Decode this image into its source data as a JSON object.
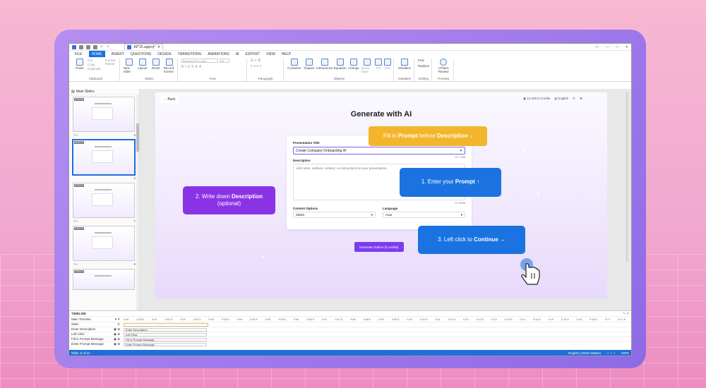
{
  "app": {
    "title": "AP'15.approj*",
    "win_controls": [
      "—",
      "□",
      "✕"
    ]
  },
  "menu": [
    "FILE",
    "HOME",
    "INSERT",
    "QUESTIONS",
    "DESIGN",
    "TRANSITIONS",
    "ANIMATIONS",
    "AI",
    "EXPORT",
    "VIEW",
    "HELP"
  ],
  "ribbon": {
    "groups": [
      {
        "name": "Clipboard",
        "buttons": [
          "Paste"
        ],
        "small": [
          "Cut",
          "Copy",
          "Duplicate",
          "Format Painter"
        ]
      },
      {
        "name": "Slides",
        "buttons": [
          "New Slide",
          "Layout",
          "Reset",
          "Record Screen"
        ]
      },
      {
        "name": "Font",
        "font": "Assistant Pro Light",
        "size": "20"
      },
      {
        "name": "Paragraph"
      },
      {
        "name": "Objects",
        "buttons": [
          "Container",
          "Shapes",
          "Interactions",
          "Equation",
          "Arrange",
          "Quick Style",
          "Fill",
          "Line"
        ]
      },
      {
        "name": "Variables",
        "buttons": [
          "Variables"
        ]
      },
      {
        "name": "Editing",
        "small": [
          "Find",
          "Replace"
        ]
      },
      {
        "name": "Preview",
        "buttons": [
          "HTML5 Review"
        ]
      }
    ]
  },
  "left_panel": {
    "title": "Main Slides",
    "thumbs": [
      {
        "num": "5",
        "tag": "0:00.18"
      },
      {
        "num": "6",
        "tag": "0:00.12"
      },
      {
        "num": "7",
        "tag": "0:00.12"
      },
      {
        "num": "8",
        "tag": "0:00.13"
      },
      {
        "num": "",
        "tag": "0:00.14"
      }
    ]
  },
  "slide": {
    "back": "Back",
    "credits": "12,325.0 Credits",
    "language": "English",
    "title": "Generate with AI",
    "form": {
      "title_label": "Presentation Title",
      "title_value": "Create Company Onboarding W",
      "title_count": "27 / 100",
      "desc_label": "Description",
      "desc_placeholder": "Add notes, outlines, content, or instructions for your presentation.",
      "desc_count": "0 / 4000",
      "content_label": "Content Options",
      "content_value": "Slides",
      "lang_label": "Language",
      "lang_value": "Auto"
    },
    "generate_btn": "Generate Outline (5 credits)"
  },
  "callouts": {
    "yellow": {
      "pre": "Fill in ",
      "b1": "Prompt",
      "mid": " before ",
      "b2": "Description",
      "post": " ↓"
    },
    "blue1": {
      "pre": "1. Enter your ",
      "b": "Prompt",
      "post": " ↑"
    },
    "purple": {
      "pre": "2. Write down ",
      "b": "Description",
      "post": "(optional)"
    },
    "blue2": {
      "pre": "3. Left click to ",
      "b": "Continue",
      "post": " →"
    }
  },
  "timeline": {
    "title": "TIMELINE",
    "main": "Main Timeline",
    "ruler": [
      "0:00",
      "0:00.5",
      "0:01",
      "0:01.5",
      "0:02",
      "0:02.5",
      "0:03",
      "0:03.5",
      "0:04",
      "0:04.5",
      "0:05",
      "0:05.5",
      "0:06",
      "0:06.5",
      "0:07",
      "0:07.5",
      "0:08",
      "0:08.5",
      "0:09",
      "0:09.5",
      "0:10",
      "0:10.5",
      "0:11",
      "0:11.5",
      "0:12",
      "0:12.5",
      "0:13",
      "0:13.5",
      "0:14",
      "0:14.5",
      "0:15",
      "0:15.5",
      "0:16",
      "0:16.5",
      "0:17",
      "0:17.5"
    ],
    "rows": [
      {
        "name": "Slide",
        "bar": ""
      },
      {
        "name": "Enter Description",
        "bar": "Enter Description"
      },
      {
        "name": "Left Click",
        "bar": "Left Click"
      },
      {
        "name": "Fill in Prompt Message",
        "bar": "Fill in Prompt Message"
      },
      {
        "name": "Enter Prompt Message",
        "bar": "Enter Prompt Message"
      }
    ]
  },
  "status": {
    "slide": "Slide: 6 of 14",
    "lang": "English (United States)",
    "zoom": "100%"
  }
}
